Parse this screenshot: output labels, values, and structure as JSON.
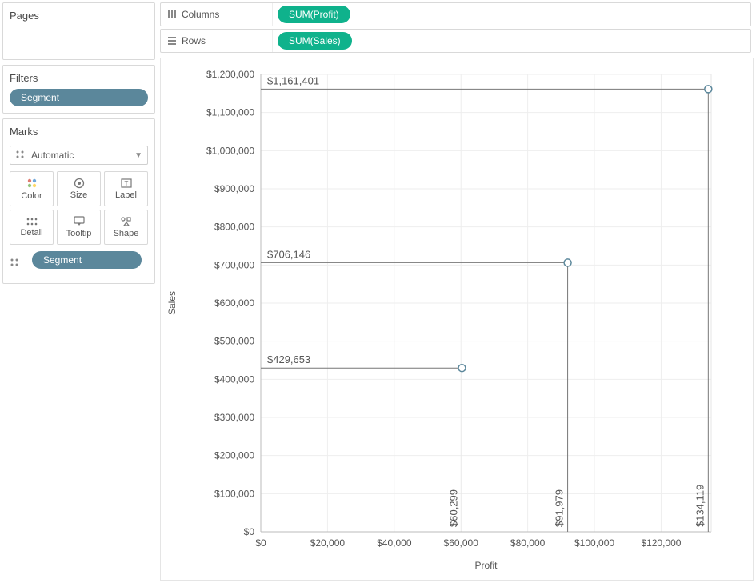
{
  "pages": {
    "title": "Pages"
  },
  "filters": {
    "title": "Filters",
    "pill_label": "Segment"
  },
  "marks": {
    "title": "Marks",
    "type_label": "Automatic",
    "buttons": {
      "color": "Color",
      "size": "Size",
      "label": "Label",
      "detail": "Detail",
      "tooltip": "Tooltip",
      "shape": "Shape"
    },
    "shape_pill_label": "Segment"
  },
  "shelves": {
    "columns_label": "Columns",
    "rows_label": "Rows",
    "columns_pill": "SUM(Profit)",
    "rows_pill": "SUM(Sales)"
  },
  "chart_data": {
    "type": "scatter",
    "xlabel": "Profit",
    "ylabel": "Sales",
    "xlim": [
      0,
      135000
    ],
    "ylim": [
      0,
      1200000
    ],
    "x_ticks": [
      0,
      20000,
      40000,
      60000,
      80000,
      100000,
      120000
    ],
    "x_tick_labels": [
      "$0",
      "$20,000",
      "$40,000",
      "$60,000",
      "$80,000",
      "$100,000",
      "$120,000"
    ],
    "y_ticks": [
      0,
      100000,
      200000,
      300000,
      400000,
      500000,
      600000,
      700000,
      800000,
      900000,
      1000000,
      1100000,
      1200000
    ],
    "y_tick_labels": [
      "$0",
      "$100,000",
      "$200,000",
      "$300,000",
      "$400,000",
      "$500,000",
      "$600,000",
      "$700,000",
      "$800,000",
      "$900,000",
      "$1,000,000",
      "$1,100,000",
      "$1,200,000"
    ],
    "points": [
      {
        "x": 60299,
        "y": 429653,
        "x_label": "$60,299",
        "y_label": "$429,653"
      },
      {
        "x": 91979,
        "y": 706146,
        "x_label": "$91,979",
        "y_label": "$706,146"
      },
      {
        "x": 134119,
        "y": 1161401,
        "x_label": "$134,119",
        "y_label": "$1,161,401"
      }
    ]
  }
}
